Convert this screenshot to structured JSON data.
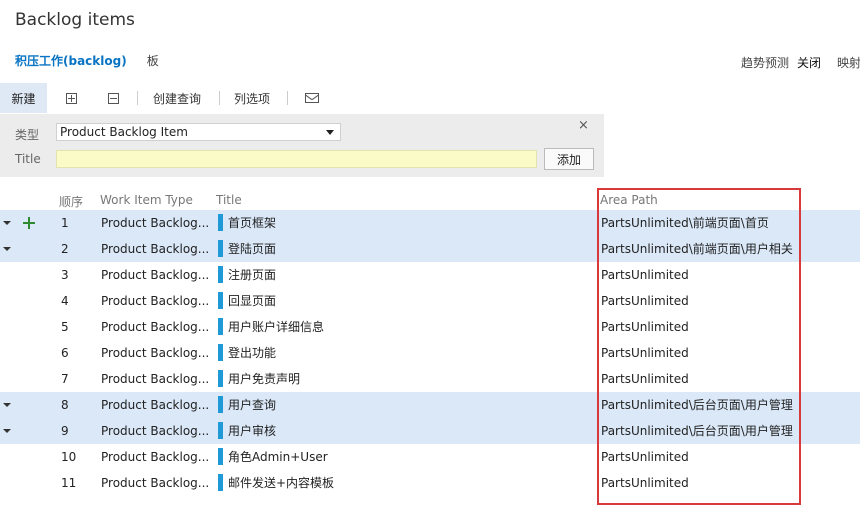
{
  "page_title": "Backlog items",
  "tabs": {
    "backlog": "积压工作(backlog)",
    "board": "板"
  },
  "right_options": {
    "forecast_label": "趋势预测",
    "forecast_value": "关闭",
    "mapping_label": "映射"
  },
  "toolbar": {
    "new_label": "新建",
    "expand_icon": "expand-all-icon",
    "collapse_icon": "collapse-all-icon",
    "create_query_label": "创建查询",
    "column_options_label": "列选项",
    "email_icon": "email-icon"
  },
  "add_panel": {
    "type_label": "类型",
    "type_value": "Product Backlog Item",
    "title_label": "Title",
    "title_value": "",
    "add_button_label": "添加",
    "close_symbol": "×"
  },
  "columns": {
    "order": "顺序",
    "type": "Work Item Type",
    "title": "Title",
    "area": "Area Path"
  },
  "accent_colors": {
    "tab_active": "#0a74c4",
    "selected_row": "#dae8f8",
    "work_item_bar": "#1f9ad6",
    "highlight_box": "#d9393a"
  },
  "rows": [
    {
      "order": "1",
      "type": "Product Backlog...",
      "title": "首页框架",
      "area": "PartsUnlimited\\前端页面\\首页",
      "selected": true,
      "has_children": true,
      "show_add": true
    },
    {
      "order": "2",
      "type": "Product Backlog...",
      "title": "登陆页面",
      "area": "PartsUnlimited\\前端页面\\用户相关",
      "selected": true,
      "has_children": true,
      "show_add": false
    },
    {
      "order": "3",
      "type": "Product Backlog...",
      "title": "注册页面",
      "area": "PartsUnlimited",
      "selected": false,
      "has_children": false,
      "show_add": false
    },
    {
      "order": "4",
      "type": "Product Backlog...",
      "title": "回显页面",
      "area": "PartsUnlimited",
      "selected": false,
      "has_children": false,
      "show_add": false
    },
    {
      "order": "5",
      "type": "Product Backlog...",
      "title": "用户账户详细信息",
      "area": "PartsUnlimited",
      "selected": false,
      "has_children": false,
      "show_add": false
    },
    {
      "order": "6",
      "type": "Product Backlog...",
      "title": "登出功能",
      "area": "PartsUnlimited",
      "selected": false,
      "has_children": false,
      "show_add": false
    },
    {
      "order": "7",
      "type": "Product Backlog...",
      "title": "用户免责声明",
      "area": "PartsUnlimited",
      "selected": false,
      "has_children": false,
      "show_add": false
    },
    {
      "order": "8",
      "type": "Product Backlog...",
      "title": "用户查询",
      "area": "PartsUnlimited\\后台页面\\用户管理",
      "selected": true,
      "has_children": true,
      "show_add": false
    },
    {
      "order": "9",
      "type": "Product Backlog...",
      "title": "用户审核",
      "area": "PartsUnlimited\\后台页面\\用户管理",
      "selected": true,
      "has_children": true,
      "show_add": false
    },
    {
      "order": "10",
      "type": "Product Backlog...",
      "title": "角色Admin+User",
      "area": "PartsUnlimited",
      "selected": false,
      "has_children": false,
      "show_add": false
    },
    {
      "order": "11",
      "type": "Product Backlog...",
      "title": "邮件发送+内容模板",
      "area": "PartsUnlimited",
      "selected": false,
      "has_children": false,
      "show_add": false
    }
  ]
}
